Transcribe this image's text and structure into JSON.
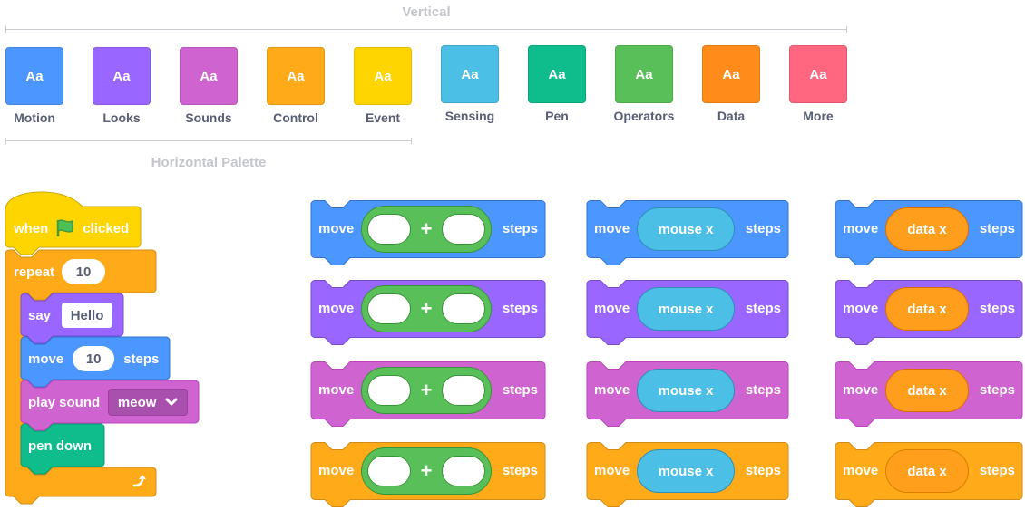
{
  "sections": {
    "vertical_label": "Vertical",
    "horizontal_label": "Horizontal Palette"
  },
  "categories": [
    {
      "name": "Motion",
      "glyph": "Aa",
      "color": "#4c97ff"
    },
    {
      "name": "Looks",
      "glyph": "Aa",
      "color": "#9966ff"
    },
    {
      "name": "Sounds",
      "glyph": "Aa",
      "color": "#cf63cf"
    },
    {
      "name": "Control",
      "glyph": "Aa",
      "color": "#ffab19"
    },
    {
      "name": "Event",
      "glyph": "Aa",
      "color": "#ffd500"
    },
    {
      "name": "Sensing",
      "glyph": "Aa",
      "color": "#4cbfe6"
    },
    {
      "name": "Pen",
      "glyph": "Aa",
      "color": "#0fbd8c"
    },
    {
      "name": "Operators",
      "glyph": "Aa",
      "color": "#59c059"
    },
    {
      "name": "Data",
      "glyph": "Aa",
      "color": "#ff8c1a"
    },
    {
      "name": "More",
      "glyph": "Aa",
      "color": "#ff6680"
    }
  ],
  "script": {
    "hat": {
      "when": "when",
      "icon": "green-flag-icon",
      "clicked": "clicked"
    },
    "repeat": {
      "label": "repeat",
      "count": "10",
      "icon": "loop-arrow-icon"
    },
    "say": {
      "label": "say",
      "value": "Hello"
    },
    "move": {
      "label": "move",
      "value": "10",
      "suffix": "steps"
    },
    "play_sound": {
      "label": "play sound",
      "value": "meow",
      "icon": "chevron-down-icon"
    },
    "pen_down": {
      "label": "pen down"
    }
  },
  "grid": {
    "move_label": "move",
    "steps_label": "steps",
    "plus": "+",
    "mouse_x": "mouse x",
    "data_x": "data x",
    "row_colors": [
      "motion",
      "looks",
      "sound",
      "control"
    ]
  }
}
